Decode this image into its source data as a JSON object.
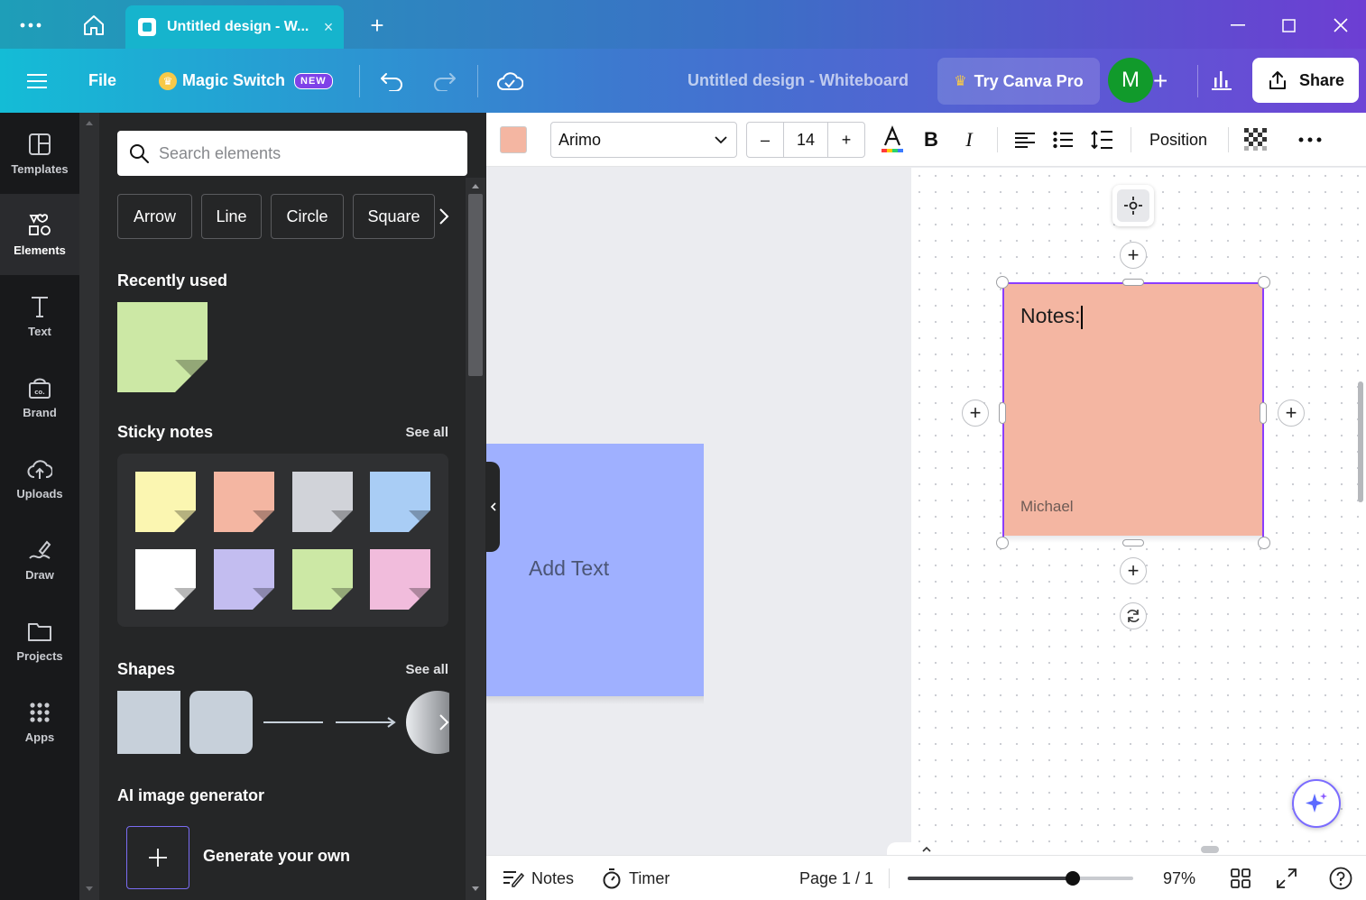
{
  "titlebar": {
    "tab_title": "Untitled design - W...",
    "menu_icon": "more-horizontal-icon",
    "home_icon": "home-icon",
    "new_tab_label": "+",
    "close_tab_label": "×"
  },
  "header": {
    "file_label": "File",
    "magic_switch_label": "Magic Switch",
    "magic_badge": "NEW",
    "doc_title": "Untitled design - Whiteboard",
    "try_pro_label": "Try Canva Pro",
    "avatar_initial": "M",
    "add_label": "+",
    "share_label": "Share"
  },
  "rail": {
    "items": [
      {
        "label": "Templates",
        "icon": "templates-icon"
      },
      {
        "label": "Elements",
        "icon": "elements-icon"
      },
      {
        "label": "Text",
        "icon": "text-icon"
      },
      {
        "label": "Brand",
        "icon": "brand-icon"
      },
      {
        "label": "Uploads",
        "icon": "cloud-upload-icon"
      },
      {
        "label": "Draw",
        "icon": "draw-icon"
      },
      {
        "label": "Projects",
        "icon": "folder-icon"
      },
      {
        "label": "Apps",
        "icon": "apps-grid-icon"
      }
    ],
    "active": "Elements"
  },
  "panel": {
    "search_placeholder": "Search elements",
    "chips": [
      "Arrow",
      "Line",
      "Circle",
      "Square"
    ],
    "recently_used_title": "Recently used",
    "sticky_title": "Sticky notes",
    "sticky_see_all": "See all",
    "sticky_colors": [
      "#fbf6b1",
      "#f4b6a2",
      "#d1d3d9",
      "#a9cdf5",
      "#ffffff",
      "#c3bdf0",
      "#cce8a5",
      "#f1bcdc"
    ],
    "recent_color": "#cce8a5",
    "shapes_title": "Shapes",
    "shapes_see_all": "See all",
    "ai_title": "AI image generator",
    "ai_generate_label": "Generate your own"
  },
  "context_bar": {
    "fill_color": "#f4b6a2",
    "font_name": "Arimo",
    "font_size": "14",
    "decrease_label": "–",
    "increase_label": "+",
    "bold_label": "B",
    "italic_label": "I",
    "position_label": "Position"
  },
  "canvas": {
    "blue_note_text": "Add Text",
    "blue_note_color": "#9fb0ff",
    "selected_note_text": "Notes:",
    "selected_note_author": "Michael",
    "selected_note_color": "#f4b6a2",
    "selection_color": "#8b3dff"
  },
  "footer": {
    "notes_label": "Notes",
    "timer_label": "Timer",
    "page_label": "Page 1 / 1",
    "zoom_label": "97%",
    "zoom_fraction": 0.73
  }
}
